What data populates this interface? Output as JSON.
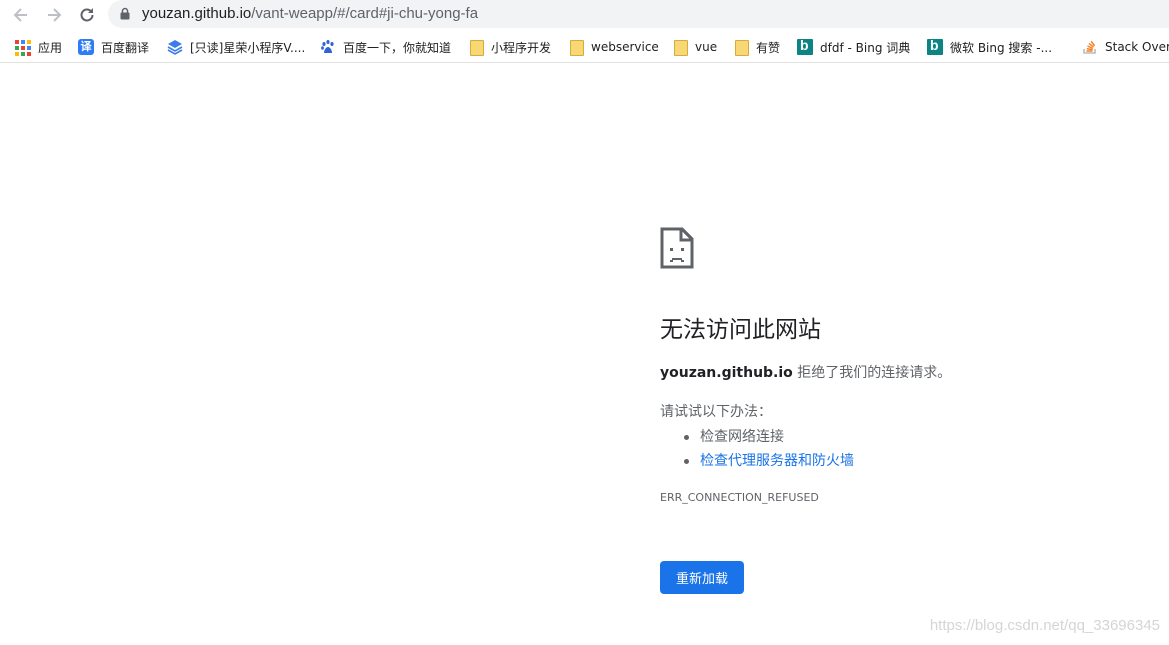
{
  "browser": {
    "url_host": "youzan.github.io",
    "url_path": "/vant-weapp/#/card#ji-chu-yong-fa"
  },
  "bookmarks": [
    {
      "label": "应用",
      "icon": "apps-grid-icon"
    },
    {
      "label": "百度翻译",
      "icon": "baidu-fanyi-icon"
    },
    {
      "label": "[只读]星荣小程序V....",
      "icon": "layers-icon"
    },
    {
      "label": "百度一下，你就知道",
      "icon": "baidu-paw-icon"
    },
    {
      "label": "小程序开发",
      "icon": "folder-icon"
    },
    {
      "label": "webservice",
      "icon": "folder-icon"
    },
    {
      "label": "vue",
      "icon": "folder-icon"
    },
    {
      "label": "有赞",
      "icon": "folder-icon"
    },
    {
      "label": "dfdf - Bing 词典",
      "icon": "bing-icon"
    },
    {
      "label": "微软 Bing 搜索 -...",
      "icon": "bing-icon"
    },
    {
      "label": "Stack Overf",
      "icon": "stackoverflow-icon"
    }
  ],
  "error": {
    "title": "无法访问此网站",
    "host": "youzan.github.io",
    "message": " 拒绝了我们的连接请求。",
    "try_label": "请试试以下办法：",
    "suggestions": [
      "检查网络连接",
      "检查代理服务器和防火墙"
    ],
    "code": "ERR_CONNECTION_REFUSED",
    "reload_label": "重新加载",
    "icon": "sad-document-icon"
  },
  "watermark": "https://blog.csdn.net/qq_33696345",
  "colors": {
    "accent": "#1a73e8",
    "text": "#202124",
    "secondary": "#5f6368"
  }
}
